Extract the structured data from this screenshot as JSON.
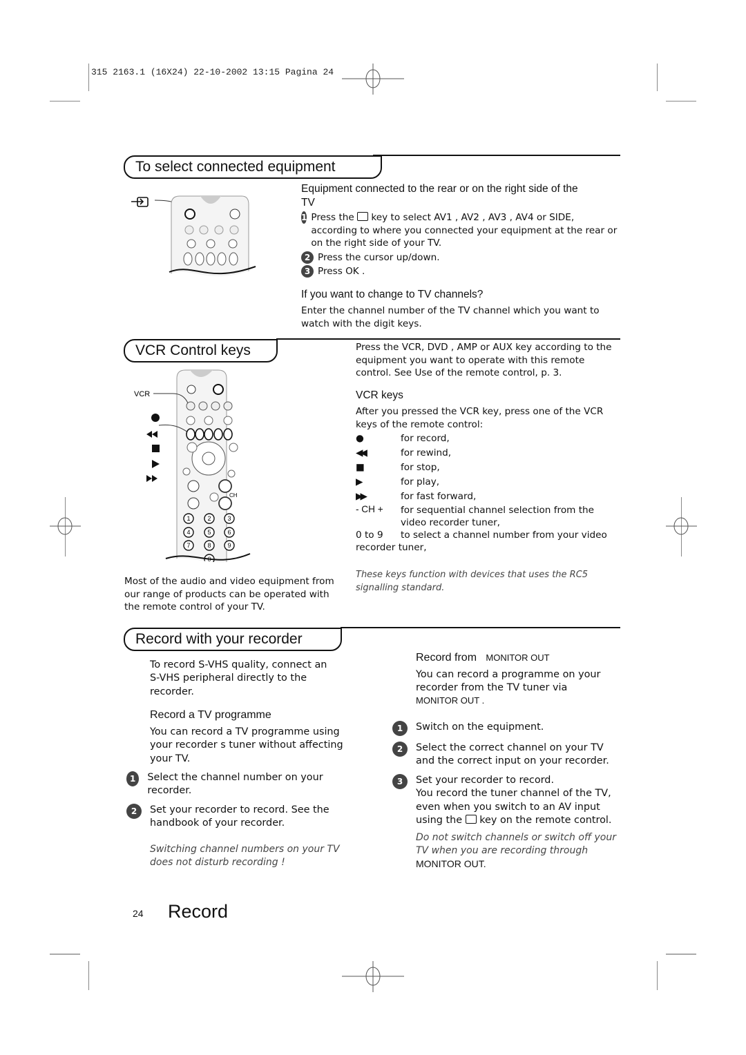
{
  "slug": "315 2163.1 (16X24)  22-10-2002  13:15  Pagina 24",
  "sections": {
    "select_equipment": {
      "title": "To select connected equipment",
      "subtitle": "Equipment connected to the rear or on the right side of the TV",
      "steps": [
        {
          "n": "1",
          "pre": "Press the",
          "post": "key to select AV1 , AV2 , AV3 , AV4  or SIDE, according to where you connected your equipment at the rear or on the right side of your TV."
        },
        {
          "n": "2",
          "text": "Press the cursor up/down."
        },
        {
          "n": "3",
          "text": "Press OK ."
        }
      ],
      "sub2": "If you want to change to TV channels?",
      "sub2_text": "Enter the channel number of the TV channel which you want to watch with the digit keys."
    },
    "vcr": {
      "title": "VCR Control keys",
      "intro": "Press the VCR, DVD , AMP  or AUX  key according to the equipment you want to operate with this remote control. See Use of the remote control, p. 3.",
      "remote_label": "VCR",
      "sub": "VCR keys",
      "sub_text": "After you pressed the VCR key, press one of the VCR keys of the remote control:",
      "keys": [
        {
          "key": "●",
          "icon": "record-icon",
          "desc": "for record,"
        },
        {
          "key": "◀◀",
          "icon": "rewind-icon",
          "desc": "for rewind,"
        },
        {
          "key": "■",
          "icon": "stop-icon",
          "desc": "for stop,"
        },
        {
          "key": "▶",
          "icon": "play-icon",
          "desc": "for play,"
        },
        {
          "key": "▶▶",
          "icon": "fast-forward-icon",
          "desc": "for fast forward,"
        },
        {
          "key": "- CH +",
          "icon": "",
          "desc": "for sequential channel selection from the video recorder tuner,"
        }
      ],
      "digits_key": "0 to 9",
      "digits_desc": "to select a channel number from your video",
      "digits_desc2": "recorder tuner,",
      "note": "These keys function with devices that uses the RC5 signalling standard.",
      "left_text": "Most of the audio and video equipment from our range of products can be operated with the remote control of your TV."
    },
    "record": {
      "title": "Record with your recorder",
      "svhs": "To record S-VHS quality, connect an S-VHS peripheral directly to the recorder.",
      "tv_sub": "Record a TV programme",
      "tv_text": "You can record a TV programme using your recorder s tuner without affecting your TV.",
      "tv_steps": [
        {
          "n": "1",
          "text": "Select the channel number on your recorder."
        },
        {
          "n": "2",
          "text": "Set your recorder to record. See the handbook of your recorder."
        }
      ],
      "tv_note": "Switching channel numbers on your TV does not disturb recording !",
      "mon_sub": "Record from",
      "mon_sub_b": "MONITOR OUT",
      "mon_text": "You can record a programme on your recorder from the TV tuner via",
      "mon_text_b": "MONITOR OUT   .",
      "mon_steps": [
        {
          "n": "1",
          "text": "Switch on the equipment."
        },
        {
          "n": "2",
          "text": "Select the correct channel on your TV and the correct input on your recorder."
        }
      ],
      "mon_step3_n": "3",
      "mon_step3_a": "Set your recorder to record.",
      "mon_step3_b": "You record the tuner channel of the TV, even when you switch to an AV input using the",
      "mon_step3_c": "key on the remote control.",
      "mon_note": "Do not switch channels or switch off your TV when you are recording through",
      "mon_note_b": "MONITOR OUT."
    }
  },
  "footer": {
    "page": "24",
    "title": "Record"
  }
}
